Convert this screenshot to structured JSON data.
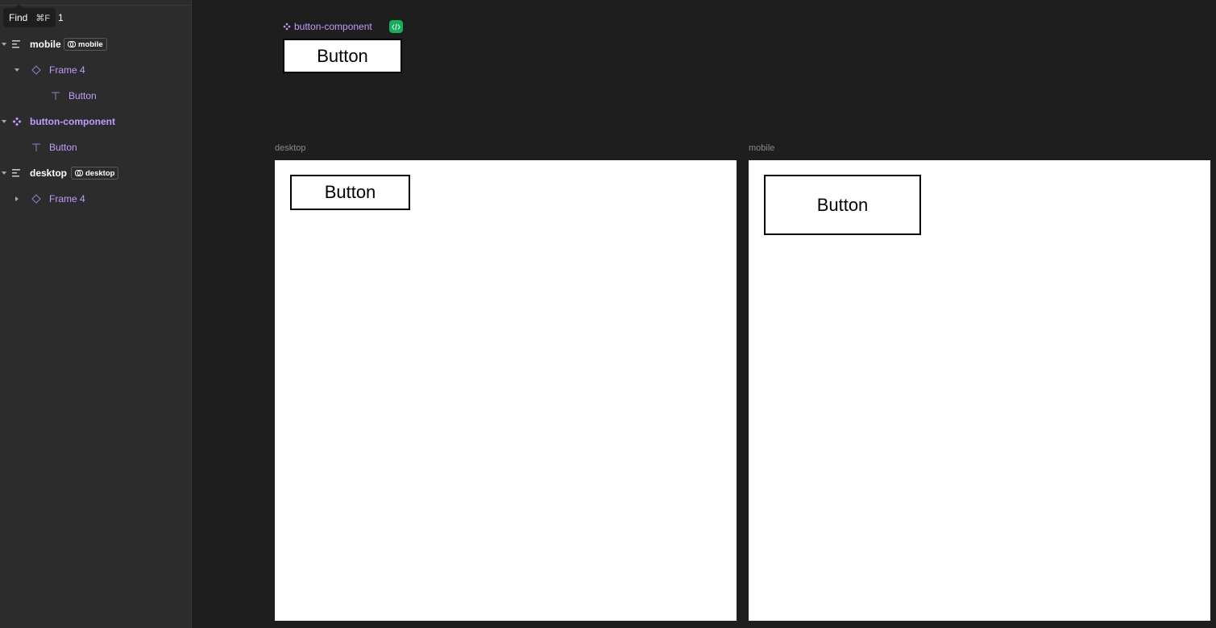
{
  "tooltip": {
    "label": "Find",
    "shortcut": "⌘F",
    "tail": "1"
  },
  "layers": {
    "mobile": {
      "name": "mobile",
      "tag": "mobile"
    },
    "mobile_frame": {
      "name": "Frame 4"
    },
    "mobile_text": {
      "name": "Button"
    },
    "component": {
      "name": "button-component"
    },
    "component_text": {
      "name": "Button"
    },
    "desktop": {
      "name": "desktop",
      "tag": "desktop"
    },
    "desktop_frame": {
      "name": "Frame 4"
    }
  },
  "canvas": {
    "component_label": "button-component",
    "component_button": "Button",
    "desktop_label": "desktop",
    "desktop_button": "Button",
    "mobile_label": "mobile",
    "mobile_button": "Button"
  },
  "colors": {
    "accent_purple": "#c39bff",
    "code_badge": "#14ae5c",
    "panel_bg": "#2c2c2c",
    "canvas_bg": "#1e1e1e"
  },
  "icons": {
    "frame_stack": "frame-stack-icon",
    "frame_instance": "instance-diamond-icon",
    "text": "text-icon",
    "component": "component-icon",
    "variable_mode": "link-mode-icon",
    "code": "code-icon"
  }
}
